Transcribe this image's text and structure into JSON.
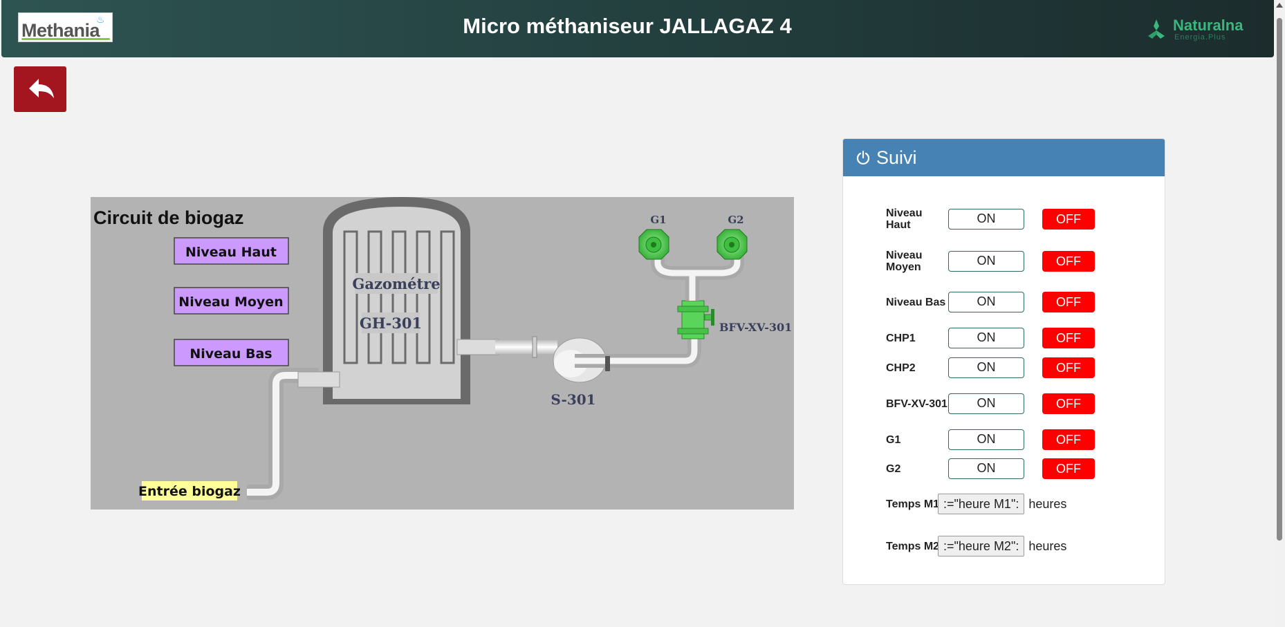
{
  "header": {
    "title": "Micro méthaniseur JALLAGAZ 4",
    "logo_left": "Methania",
    "logo_right_main": "Naturalna",
    "logo_right_sub": "Energia.Plus",
    "bg_color": "#2e5452"
  },
  "back_button": {
    "icon": "reply-arrow-icon",
    "color": "#a3151f"
  },
  "diagram": {
    "title": "Circuit de biogaz",
    "level_high": "Niveau Haut",
    "level_mid": "Niveau Moyen",
    "level_low": "Niveau Bas",
    "gasometer": "Gazométre",
    "gasometer_tag": "GH-301",
    "blower_tag": "S-301",
    "valve_tag": "BFV-XV-301",
    "g1": "G1",
    "g2": "G2",
    "inlet": "Entrée biogaz"
  },
  "panel": {
    "title": "Suivi",
    "header_color": "#4682b4",
    "rows": [
      {
        "label": "Niveau Haut",
        "on": "ON",
        "off": "OFF"
      },
      {
        "label": "Niveau Moyen",
        "on": "ON",
        "off": "OFF"
      },
      {
        "label": "Niveau Bas",
        "on": "ON",
        "off": "OFF"
      },
      {
        "label": "CHP1",
        "on": "ON",
        "off": "OFF"
      },
      {
        "label": "CHP2",
        "on": "ON",
        "off": "OFF"
      },
      {
        "label": "BFV-XV-301",
        "on": "ON",
        "off": "OFF"
      },
      {
        "label": "G1",
        "on": "ON",
        "off": "OFF"
      },
      {
        "label": "G2",
        "on": "ON",
        "off": "OFF"
      }
    ],
    "times": [
      {
        "label": "Temps M1",
        "value": ":=\"heure M1\":",
        "unit": "heures"
      },
      {
        "label": "Temps M2",
        "value": ":=\"heure M2\":",
        "unit": "heures"
      }
    ]
  }
}
